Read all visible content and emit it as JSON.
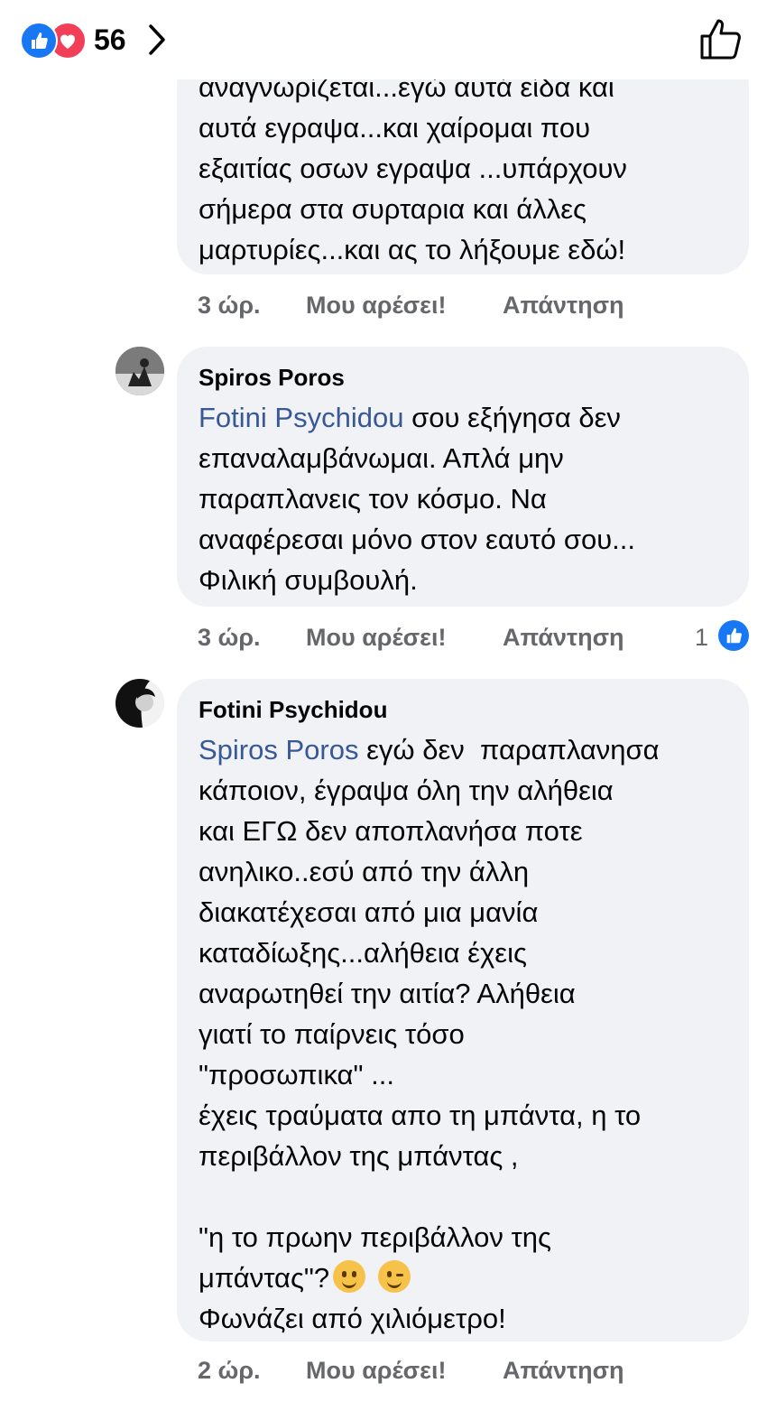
{
  "header": {
    "reaction_count": "56",
    "icons": {
      "like": "like-reaction-icon",
      "love": "love-reaction-icon",
      "chevron": "chevron-right-icon",
      "thumb": "thumbs-up-outline-icon"
    },
    "colors": {
      "like": "#1877f2",
      "love": "#f33e58"
    }
  },
  "comments": [
    {
      "text_lines": [
        "αναγνωρίζεται...εγώ αυτά είδα και",
        "αυτά εγραψα...και χαίρομαι που",
        "εξαιτίας οσων εγραψα ...υπάρχουν",
        "σήμερα στα συρταρια και άλλες",
        "μαρτυρίες...και ας το λήξουμε εδώ!"
      ],
      "time": "3 ώρ.",
      "like_label": "Μου αρέσει!",
      "reply_label": "Απάντηση"
    },
    {
      "author": "Spiros Poros",
      "mention": "Fotini Psychidou",
      "text_first": " σου εξήγησα δεν",
      "text_rest": [
        "επαναλαμβάνωμαι. Απλά μην",
        "παραπλανεις τον κόσμο. Να",
        "αναφέρεσαι μόνο στον εαυτό σου...",
        "Φιλική συμβουλή."
      ],
      "time": "3 ώρ.",
      "like_label": "Μου αρέσει!",
      "reply_label": "Απάντηση",
      "likes": "1"
    },
    {
      "author": "Fotini Psychidou",
      "mention": "Spiros Poros",
      "text_first": " εγώ δεν  παραπλανησα",
      "text_rest": [
        "κάποιον, έγραψα όλη την αλήθεια",
        "και ΕΓΩ δεν αποπλανήσα ποτε",
        "ανηλικο..εσύ από την άλλη",
        "διακατέχεσαι από μια μανία",
        "καταδίωξης...αλήθεια έχεις",
        "αναρωτηθεί την αιτία? Αλήθεια",
        "γιατί το παίρνεις τόσο",
        "\"προσωπικα\" ...",
        "έχεις τραύματα απο τη μπάντα, η το",
        "περιβάλλον της μπάντας ,",
        "",
        "\"η το πρωην περιβάλλον της"
      ],
      "emoji_line_text": "μπάντας\"?",
      "last_line": "Φωνάζει από χιλιόμετρο!",
      "time": "2 ώρ.",
      "like_label": "Μου αρέσει!",
      "reply_label": "Απάντηση"
    }
  ]
}
